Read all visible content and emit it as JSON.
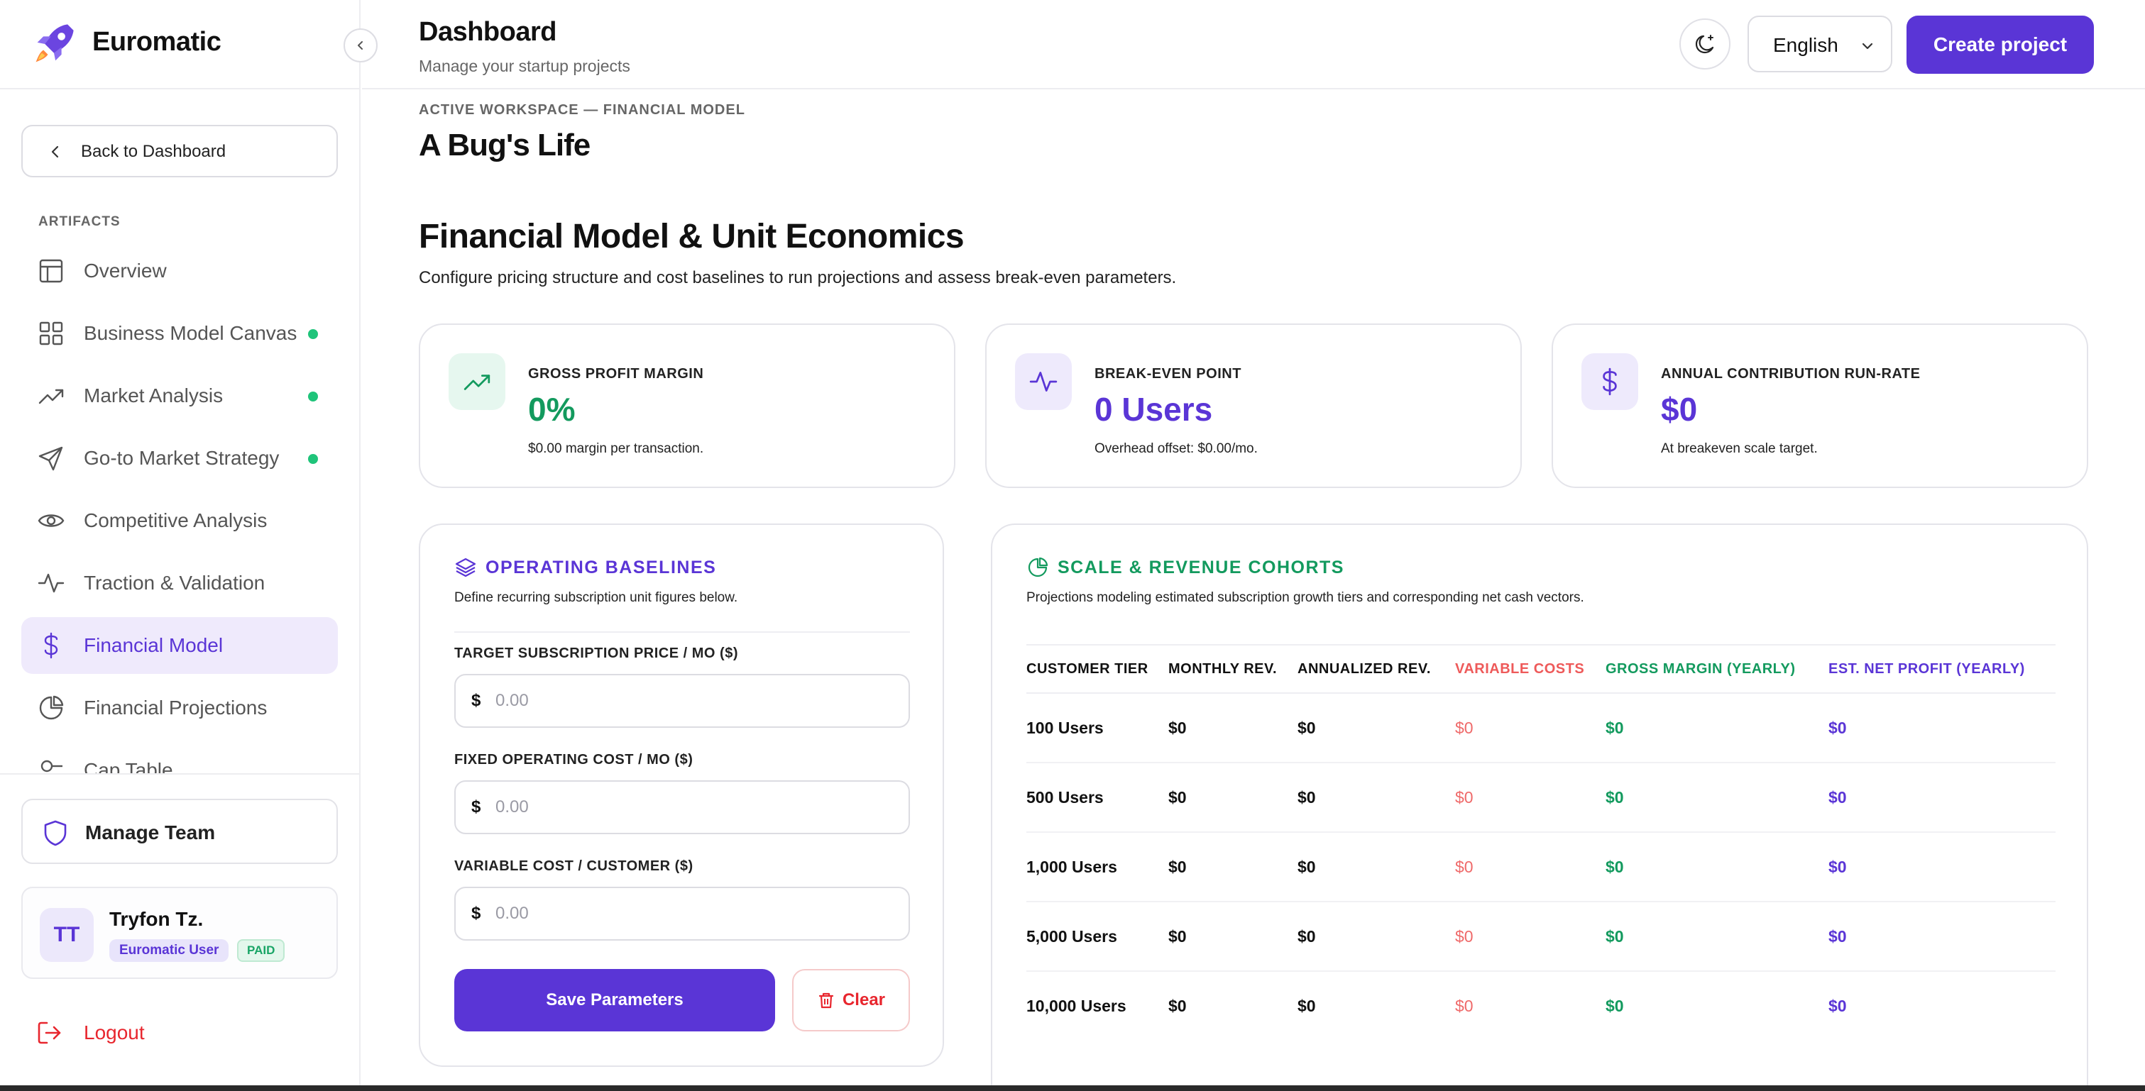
{
  "brand": {
    "name": "Euromatic"
  },
  "sidebar": {
    "back_label": "Back to Dashboard",
    "section_label": "ARTIFACTS",
    "items": [
      {
        "label": "Overview",
        "icon": "layout-icon",
        "dot": false,
        "active": false
      },
      {
        "label": "Business Model Canvas",
        "icon": "grid-icon",
        "dot": true,
        "active": false
      },
      {
        "label": "Market Analysis",
        "icon": "trending-up-icon",
        "dot": true,
        "active": false
      },
      {
        "label": "Go-to Market Strategy",
        "icon": "send-icon",
        "dot": true,
        "active": false
      },
      {
        "label": "Competitive Analysis",
        "icon": "eye-icon",
        "dot": false,
        "active": false
      },
      {
        "label": "Traction & Validation",
        "icon": "activity-icon",
        "dot": false,
        "active": false
      },
      {
        "label": "Financial Model",
        "icon": "dollar-icon",
        "dot": false,
        "active": true
      },
      {
        "label": "Financial Projections",
        "icon": "pie-chart-icon",
        "dot": false,
        "active": false
      },
      {
        "label": "Cap Table",
        "icon": "cap-table-icon",
        "dot": false,
        "active": false
      }
    ],
    "manage_team_label": "Manage Team",
    "user": {
      "initials": "TT",
      "name": "Tryfon Tz.",
      "role": "Euromatic User",
      "plan": "PAID"
    },
    "logout_label": "Logout"
  },
  "header": {
    "title": "Dashboard",
    "subtitle": "Manage your startup projects",
    "language": "English",
    "create_label": "Create project"
  },
  "main": {
    "workspace_label": "ACTIVE WORKSPACE — FINANCIAL MODEL",
    "workspace_name": "A Bug's Life",
    "title": "Financial Model & Unit Economics",
    "subtitle": "Configure pricing structure and cost baselines to run projections and assess break-even parameters.",
    "kpis": [
      {
        "label": "GROSS PROFIT MARGIN",
        "value": "0%",
        "sub": "$0.00 margin per transaction.",
        "color": "#139a5e",
        "bg": "#e6f7ef",
        "icon": "trending-up-icon"
      },
      {
        "label": "BREAK-EVEN POINT",
        "value": "0 Users",
        "sub": "Overhead offset: $0.00/mo.",
        "color": "#5a35d6",
        "bg": "#eeeafc",
        "icon": "activity-icon"
      },
      {
        "label": "ANNUAL CONTRIBUTION RUN-RATE",
        "value": "$0",
        "sub": "At breakeven scale target.",
        "color": "#5a35d6",
        "bg": "#eeeafc",
        "icon": "dollar-icon"
      }
    ],
    "baselines": {
      "title": "OPERATING BASELINES",
      "desc": "Define recurring subscription unit figures below.",
      "fields": [
        {
          "label": "TARGET SUBSCRIPTION PRICE / MO ($)",
          "currency": "$",
          "placeholder": "0.00"
        },
        {
          "label": "FIXED OPERATING COST / MO ($)",
          "currency": "$",
          "placeholder": "0.00"
        },
        {
          "label": "VARIABLE COST / CUSTOMER ($)",
          "currency": "$",
          "placeholder": "0.00"
        }
      ],
      "save_label": "Save Parameters",
      "clear_label": "Clear"
    },
    "cohorts": {
      "title": "SCALE & REVENUE COHORTS",
      "desc": "Projections modeling estimated subscription growth tiers and corresponding net cash vectors.",
      "headers": [
        "CUSTOMER TIER",
        "MONTHLY REV.",
        "ANNUALIZED REV.",
        "VARIABLE COSTS",
        "GROSS MARGIN (YEARLY)",
        "EST. NET PROFIT (YEARLY)"
      ],
      "rows": [
        [
          "100 Users",
          "$0",
          "$0",
          "$0",
          "$0",
          "$0"
        ],
        [
          "500 Users",
          "$0",
          "$0",
          "$0",
          "$0",
          "$0"
        ],
        [
          "1,000 Users",
          "$0",
          "$0",
          "$0",
          "$0",
          "$0"
        ],
        [
          "5,000 Users",
          "$0",
          "$0",
          "$0",
          "$0",
          "$0"
        ],
        [
          "10,000 Users",
          "$0",
          "$0",
          "$0",
          "$0",
          "$0"
        ]
      ]
    }
  },
  "colors": {
    "accent": "#5a35d6",
    "success": "#139a5e",
    "danger": "#e8262e"
  }
}
